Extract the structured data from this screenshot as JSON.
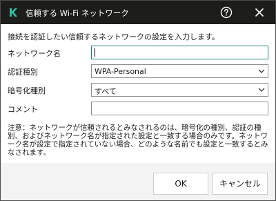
{
  "window": {
    "title": "信頼する Wi-Fi ネットワーク",
    "icon": "kaspersky-k-icon",
    "accent_color": "#1d7f73",
    "titlebar_color": "#1d1d1b"
  },
  "form": {
    "instruction": "接続を認証したい信頼するネットワークの設定を入力します。",
    "network_name": {
      "label": "ネットワーク名",
      "value": ""
    },
    "auth_type": {
      "label": "認証種別",
      "value": "WPA-Personal"
    },
    "encryption_type": {
      "label": "暗号化種別",
      "value": "すべて"
    },
    "comment": {
      "label": "コメント",
      "value": ""
    }
  },
  "note": "注意：ネットワークが信頼されるとみなされるのは、暗号化の種別、認証の種別、およびネットワーク名が指定された設定と一致する場合のみです。ネットワーク名が設定で指定されていない場合、どのような名前でも設定と一致するとみなされます。",
  "buttons": {
    "ok": "OK",
    "cancel": "キャンセル"
  }
}
